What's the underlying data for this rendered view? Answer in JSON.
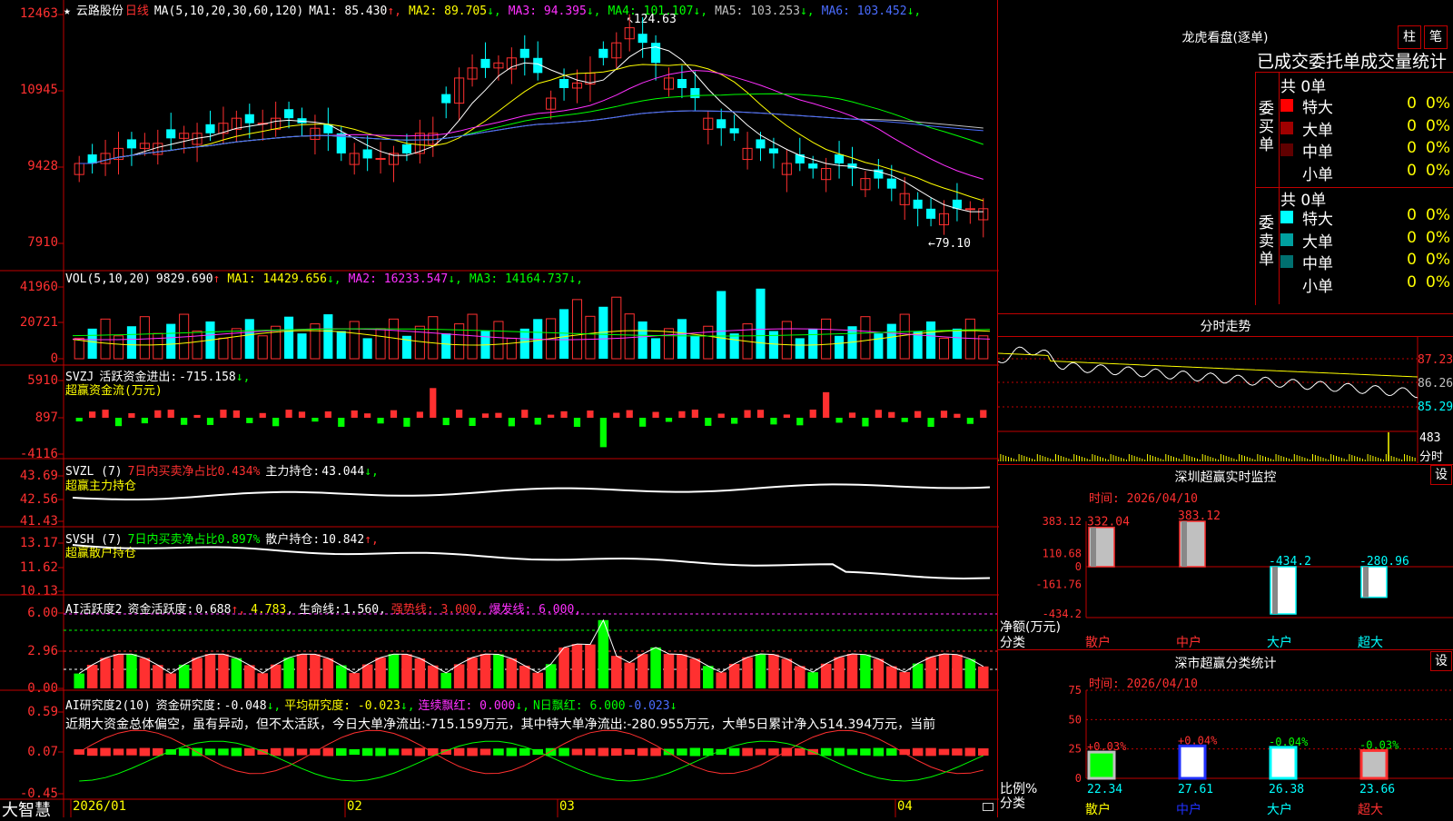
{
  "stock": {
    "name": "云路股份",
    "period": "日线"
  },
  "main": {
    "ma_def": "MA(5,10,20,30,60,120)",
    "ma": [
      {
        "label": "MA1:",
        "value": "85.430",
        "arrow": "↑",
        "color": "#ffffff"
      },
      {
        "label": "MA2:",
        "value": "89.705",
        "arrow": "↓",
        "color": "#ffff00"
      },
      {
        "label": "MA3:",
        "value": "94.395",
        "arrow": "↓",
        "color": "#ff30ff"
      },
      {
        "label": "MA4:",
        "value": "101.107",
        "arrow": "↓",
        "color": "#00ff00"
      },
      {
        "label": "MA5:",
        "value": "103.253",
        "arrow": "↓",
        "color": "#c0c0c0"
      },
      {
        "label": "MA6:",
        "value": "103.452",
        "arrow": "↓",
        "color": "#4a6cff"
      }
    ],
    "y_ticks": [
      "12463",
      "10945",
      "9428",
      "7910"
    ],
    "high_label": "124.63",
    "low_label": "79.10"
  },
  "vol": {
    "title": "VOL(5,10,20)",
    "value": "9829.690",
    "ma": [
      {
        "label": "MA1:",
        "value": "14429.656",
        "arrow": "↓",
        "color": "#ffff00"
      },
      {
        "label": "MA2:",
        "value": "16233.547",
        "arrow": "↓",
        "color": "#ff30ff"
      },
      {
        "label": "MA3:",
        "value": "14164.737",
        "arrow": "↓",
        "color": "#00ff00"
      }
    ],
    "y_ticks": [
      "41960",
      "20721",
      "0"
    ]
  },
  "svzj": {
    "title": "SVZJ",
    "label": "活跃资金进出:",
    "value": "-715.158",
    "sub": "超赢资金流(万元)",
    "y_ticks": [
      "5910",
      "897",
      "-4116"
    ]
  },
  "svzl": {
    "title": "SVZL (7)",
    "hint": "7日内买卖净占比0.434%",
    "label": "主力持仓:",
    "value": "43.044",
    "sub": "超赢主力持仓",
    "y_ticks": [
      "43.69",
      "42.56",
      "41.43"
    ]
  },
  "svsh": {
    "title": "SVSH (7)",
    "hint": "7日内买卖净占比0.897%",
    "label": "散户持仓:",
    "value": "10.842",
    "sub": "超赢散户持仓",
    "y_ticks": [
      "13.17",
      "11.62",
      "10.13"
    ]
  },
  "ai_active": {
    "title": "AI活跃度2",
    "label": "资金活跃度:",
    "v1": "0.688",
    "v2": "4.783",
    "life_label": "生命线:",
    "life": "1.560",
    "strong": "强势线: 3.000",
    "burst": "爆发线: 6.000",
    "y_ticks": [
      "6.00",
      "2.96",
      "0.00"
    ]
  },
  "ai_research": {
    "title": "AI研究度2(10)",
    "label": "资金研究度:",
    "value": "-0.048",
    "avg": "平均研究度: -0.023",
    "red_label": "连续飘红: 0.000",
    "n_red": "N日飘红: 6.000",
    "n_val": "-0.023",
    "comment": "近期大资金总体偏空，虽有异动，但不太活跃，今日大单净流出:-715.159万元，其中特大单净流出:-280.955万元，大单5日累计净入514.394万元，当前",
    "y_ticks": [
      "0.59",
      "0.07",
      "-0.45"
    ]
  },
  "x_axis": [
    "2026/01",
    "02",
    "03",
    "04"
  ],
  "brand": "大智慧",
  "right": {
    "dragon_title": "龙虎看盘(逐单)",
    "btn_bar": "柱",
    "btn_pen": "笔",
    "header": "已成交委托单成交量统计",
    "buy_total": "共 0单",
    "sell_total": "共 0单",
    "buy_side": "委买单",
    "sell_side": "委卖单",
    "buy_rows": [
      {
        "name": "特大",
        "count": "0",
        "pct": "0%",
        "color": "#ff0000"
      },
      {
        "name": "大单",
        "count": "0",
        "pct": "0%",
        "color": "#a00000"
      },
      {
        "name": "中单",
        "count": "0",
        "pct": "0%",
        "color": "#600000"
      },
      {
        "name": "小单",
        "count": "0",
        "pct": "0%",
        "color": "#000000"
      }
    ],
    "sell_rows": [
      {
        "name": "特大",
        "count": "0",
        "pct": "0%",
        "color": "#00ffff"
      },
      {
        "name": "大单",
        "count": "0",
        "pct": "0%",
        "color": "#00a0a0"
      },
      {
        "name": "中单",
        "count": "0",
        "pct": "0%",
        "color": "#007070"
      },
      {
        "name": "小单",
        "count": "0",
        "pct": "0%",
        "color": "#000000"
      }
    ],
    "intraday_title": "分时走势",
    "intraday_ticks": [
      "87.23",
      "86.26",
      "85.29"
    ],
    "intraday_vol": "483",
    "intraday_vol_unit": "分时",
    "sz_title": "深圳超赢实时监控",
    "sz_time": "时间: 2026/04/10",
    "sz_btn": "设",
    "sz_ticks": [
      "383.12",
      "110.68",
      "0",
      "-161.76",
      "-434.2"
    ],
    "sz_ylabel": "净额(万元)",
    "sz_xlabel": "分类",
    "sz_cls_title": "深市超赢分类统计",
    "sz_cls_time": "时间: 2026/04/10",
    "sz_cls_btn": "设",
    "sz_cls_ticks": [
      "75",
      "50",
      "25",
      "0"
    ],
    "sz_cls_ylabel": "比例%",
    "sz_cls_xlabel": "分类"
  },
  "chart_data": [
    {
      "type": "bar",
      "title": "深圳超赢实时监控",
      "categories": [
        "散户",
        "中户",
        "大户",
        "超大"
      ],
      "values": [
        332.04,
        383.12,
        -434.2,
        -280.96
      ],
      "ylabel": "净额(万元)",
      "ylim": [
        -434.2,
        383.12
      ]
    },
    {
      "type": "bar",
      "title": "深市超赢分类统计",
      "categories": [
        "散户",
        "中户",
        "大户",
        "超大"
      ],
      "values": [
        22.34,
        27.61,
        26.38,
        23.66
      ],
      "changes": [
        "+0.03%",
        "+0.04%",
        "-0.04%",
        "-0.03%"
      ],
      "ylabel": "比例%",
      "ylim": [
        0,
        75
      ]
    },
    {
      "type": "bar",
      "title": "日线K线",
      "categories_range": [
        "2026/01",
        "04"
      ],
      "high": 124.63,
      "low": 79.1,
      "ylim": [
        79.1,
        124.63
      ],
      "candles_close": [
        95,
        95,
        97,
        98,
        98,
        99,
        99,
        100,
        101,
        101,
        101,
        103,
        104,
        103,
        103,
        104,
        104,
        103,
        102,
        101,
        97,
        97,
        96,
        96,
        97,
        97,
        101,
        101,
        107,
        112,
        114,
        114,
        115,
        116,
        116,
        113,
        108,
        110,
        111,
        113,
        116,
        119,
        122,
        119,
        115,
        112,
        110,
        108,
        104,
        102,
        101,
        98,
        98,
        97,
        95,
        95,
        94,
        94,
        95,
        94,
        92,
        92,
        90,
        89,
        86,
        84,
        85,
        86,
        86,
        86
      ]
    }
  ]
}
